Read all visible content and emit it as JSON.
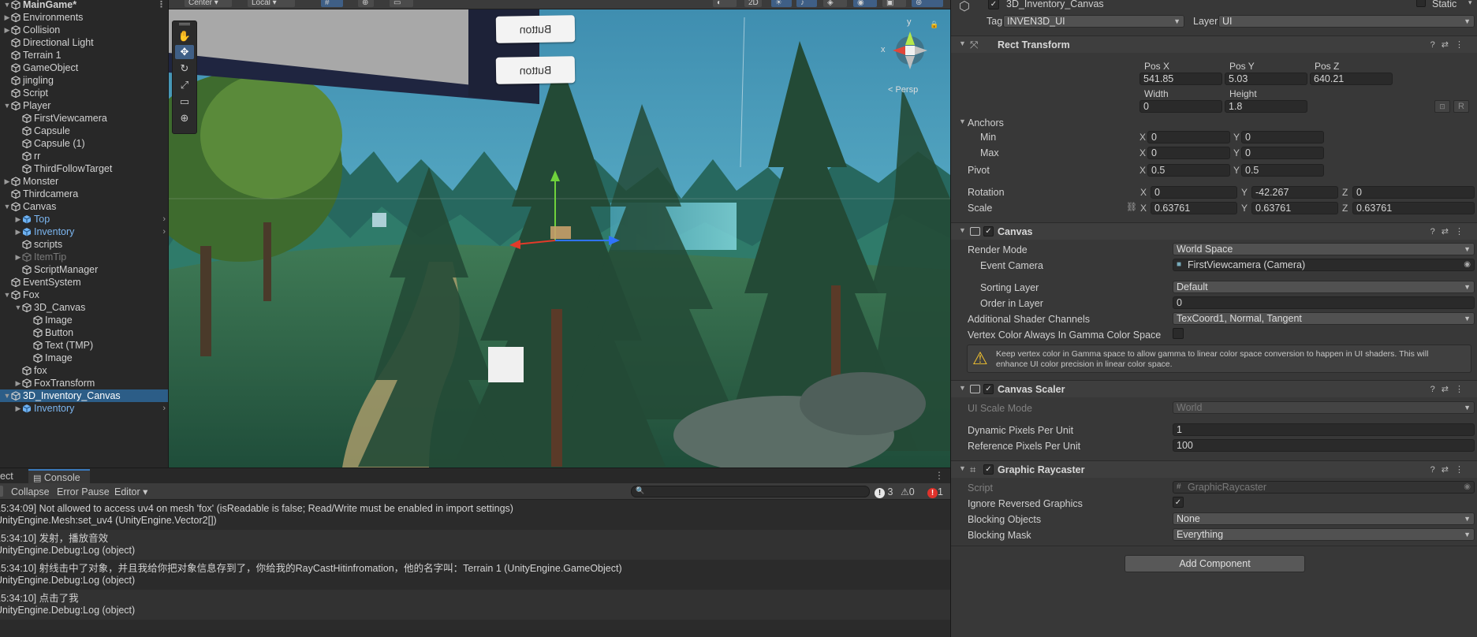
{
  "hierarchy": {
    "items": [
      {
        "label": "MainGame*",
        "arrow": "▼",
        "depth": 0,
        "scene": true
      },
      {
        "label": "Environments",
        "arrow": "▶",
        "depth": 0
      },
      {
        "label": "Collision",
        "arrow": "▶",
        "depth": 0
      },
      {
        "label": "Directional Light",
        "arrow": "",
        "depth": 0
      },
      {
        "label": "Terrain 1",
        "arrow": "",
        "depth": 0
      },
      {
        "label": "GameObject",
        "arrow": "",
        "depth": 0
      },
      {
        "label": "jingling",
        "arrow": "",
        "depth": 0
      },
      {
        "label": "Script",
        "arrow": "",
        "depth": 0
      },
      {
        "label": "Player",
        "arrow": "▼",
        "depth": 0
      },
      {
        "label": "FirstViewcamera",
        "arrow": "",
        "depth": 1
      },
      {
        "label": "Capsule",
        "arrow": "",
        "depth": 1
      },
      {
        "label": "Capsule (1)",
        "arrow": "",
        "depth": 1
      },
      {
        "label": "rr",
        "arrow": "",
        "depth": 1
      },
      {
        "label": "ThirdFollowTarget",
        "arrow": "",
        "depth": 1
      },
      {
        "label": "Monster",
        "arrow": "▶",
        "depth": 0
      },
      {
        "label": "Thirdcamera",
        "arrow": "",
        "depth": 0
      },
      {
        "label": "Canvas",
        "arrow": "▼",
        "depth": 0
      },
      {
        "label": "Top",
        "arrow": "▶",
        "depth": 1,
        "blue": true,
        "more": true
      },
      {
        "label": "Inventory",
        "arrow": "▶",
        "depth": 1,
        "blue": true,
        "more": true
      },
      {
        "label": "scripts",
        "arrow": "",
        "depth": 1
      },
      {
        "label": "ItemTip",
        "arrow": "▶",
        "depth": 1,
        "disabled": true
      },
      {
        "label": "ScriptManager",
        "arrow": "",
        "depth": 1
      },
      {
        "label": "EventSystem",
        "arrow": "",
        "depth": 0
      },
      {
        "label": "Fox",
        "arrow": "▼",
        "depth": 0
      },
      {
        "label": "3D_Canvas",
        "arrow": "▼",
        "depth": 1
      },
      {
        "label": "Image",
        "arrow": "",
        "depth": 2
      },
      {
        "label": "Button",
        "arrow": "",
        "depth": 2
      },
      {
        "label": "Text (TMP)",
        "arrow": "",
        "depth": 2
      },
      {
        "label": "Image",
        "arrow": "",
        "depth": 2
      },
      {
        "label": "fox",
        "arrow": "",
        "depth": 1
      },
      {
        "label": "FoxTransform",
        "arrow": "▶",
        "depth": 1
      },
      {
        "label": "3D_Inventory_Canvas",
        "arrow": "▼",
        "depth": 0,
        "selected": true
      },
      {
        "label": "Inventory",
        "arrow": "▶",
        "depth": 1,
        "blue": true,
        "more": true
      }
    ]
  },
  "scene": {
    "toolbar": {
      "pivot": "Center",
      "space": "Local",
      "mode2d": "2D"
    },
    "buttons": [
      "Button",
      "Button"
    ],
    "persp_label": "< Persp",
    "axis_x": "x",
    "axis_y": "y"
  },
  "console": {
    "tabs": [
      "ect",
      "Console"
    ],
    "toolbar": {
      "collapse": "Collapse",
      "error_pause": "Error Pause",
      "editor": "Editor"
    },
    "counts": {
      "info": "3",
      "warn": "0",
      "error": "1"
    },
    "logs": [
      {
        "line1": "15:34:09] Not allowed to access uv4 on mesh 'fox' (isReadable is false; Read/Write must be enabled in import settings)",
        "line2": "UnityEngine.Mesh:set_uv4 (UnityEngine.Vector2[])"
      },
      {
        "line1": "15:34:10] 发射，播放音效",
        "line2": "UnityEngine.Debug:Log (object)"
      },
      {
        "line1": "15:34:10] 射线击中了对象，并且我给你把对象信息存到了，你给我的RayCastHitinfromation，他的名字叫：Terrain 1 (UnityEngine.GameObject)",
        "line2": "UnityEngine.Debug:Log (object)"
      },
      {
        "line1": "15:34:10] 点击了我",
        "line2": "UnityEngine.Debug:Log (object)"
      }
    ]
  },
  "inspector": {
    "object_name": "3D_Inventory_Canvas",
    "static_label": "Static",
    "tag_label": "Tag",
    "tag_value": "INVEN3D_UI",
    "layer_label": "Layer",
    "layer_value": "UI",
    "rect_transform": {
      "title": "Rect Transform",
      "posx_label": "Pos X",
      "posy_label": "Pos Y",
      "posz_label": "Pos Z",
      "posx": "541.85",
      "posy": "5.03",
      "posz": "640.21",
      "width_label": "Width",
      "height_label": "Height",
      "width": "0",
      "height": "1.8",
      "r_label": "R",
      "anchors_label": "Anchors",
      "min_label": "Min",
      "max_label": "Max",
      "anchor_min_x": "0",
      "anchor_min_y": "0",
      "anchor_max_x": "0",
      "anchor_max_y": "0",
      "pivot_label": "Pivot",
      "pivot_x": "0.5",
      "pivot_y": "0.5",
      "rotation_label": "Rotation",
      "rot_x": "0",
      "rot_y": "-42.267",
      "rot_z": "0",
      "scale_label": "Scale",
      "scale_x": "0.63761",
      "scale_y": "0.63761",
      "scale_z": "0.63761"
    },
    "canvas": {
      "title": "Canvas",
      "render_mode_label": "Render Mode",
      "render_mode": "World Space",
      "event_camera_label": "Event Camera",
      "event_camera": "FirstViewcamera (Camera)",
      "sorting_layer_label": "Sorting Layer",
      "sorting_layer": "Default",
      "order_label": "Order in Layer",
      "order": "0",
      "shader_channels_label": "Additional Shader Channels",
      "shader_channels": "TexCoord1, Normal, Tangent",
      "vertex_color_label": "Vertex Color Always In Gamma Color Space",
      "warning_line1": "Keep vertex color in Gamma space to allow gamma to linear color space conversion to happen in UI shaders. This will",
      "warning_line2": "enhance UI color precision in linear color space."
    },
    "canvas_scaler": {
      "title": "Canvas Scaler",
      "ui_scale_label": "UI Scale Mode",
      "ui_scale": "World",
      "dpu_label": "Dynamic Pixels Per Unit",
      "dpu": "1",
      "rppu_label": "Reference Pixels Per Unit",
      "rppu": "100"
    },
    "graphic_raycaster": {
      "title": "Graphic Raycaster",
      "script_label": "Script",
      "script": "GraphicRaycaster",
      "ignore_label": "Ignore Reversed Graphics",
      "blocking_objects_label": "Blocking Objects",
      "blocking_objects": "None",
      "blocking_mask_label": "Blocking Mask",
      "blocking_mask": "Everything"
    },
    "add_component": "Add Component"
  }
}
